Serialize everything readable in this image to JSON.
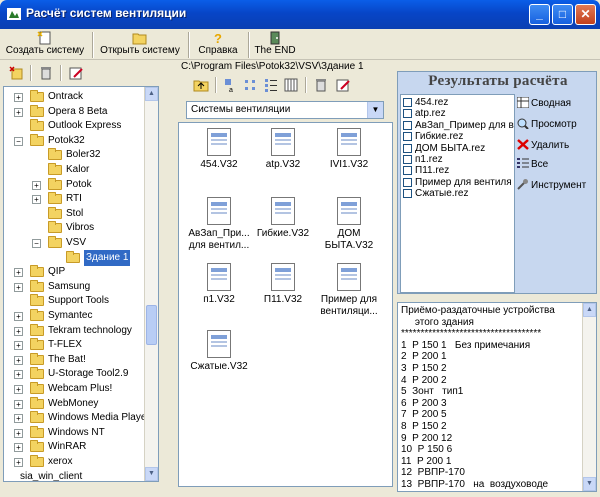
{
  "window": {
    "title": "Расчёт систем вентиляции",
    "minimize": "_",
    "maximize": "□",
    "close": "✕"
  },
  "toolbar": {
    "create": "Создать систему",
    "open": "Открыть систему",
    "help": "Справка",
    "end": "The END"
  },
  "path": "C:\\Program Files\\Potok32\\VSV\\Здание 1",
  "folder_combo": "Системы вентиляции",
  "tree": [
    {
      "label": "Ontrack",
      "expander": "+",
      "indent": 0
    },
    {
      "label": "Opera 8 Beta",
      "expander": "+",
      "indent": 0
    },
    {
      "label": "Outlook Express",
      "expander": "",
      "indent": 0
    },
    {
      "label": "Potok32",
      "expander": "−",
      "indent": 0
    },
    {
      "label": "Boler32",
      "expander": "",
      "indent": 1
    },
    {
      "label": "Kalor",
      "expander": "",
      "indent": 1
    },
    {
      "label": "Potok",
      "expander": "+",
      "indent": 1
    },
    {
      "label": "RTI",
      "expander": "+",
      "indent": 1
    },
    {
      "label": "Stol",
      "expander": "",
      "indent": 1
    },
    {
      "label": "Vibros",
      "expander": "",
      "indent": 1
    },
    {
      "label": "VSV",
      "expander": "−",
      "indent": 1
    },
    {
      "label": "Здание 1",
      "expander": "",
      "indent": 2,
      "selected": true
    },
    {
      "label": "QIP",
      "expander": "+",
      "indent": 0
    },
    {
      "label": "Samsung",
      "expander": "+",
      "indent": 0
    },
    {
      "label": "Support Tools",
      "expander": "",
      "indent": 0
    },
    {
      "label": "Symantec",
      "expander": "+",
      "indent": 0
    },
    {
      "label": "Tekram technology",
      "expander": "+",
      "indent": 0
    },
    {
      "label": "T-FLEX",
      "expander": "+",
      "indent": 0
    },
    {
      "label": "The Bat!",
      "expander": "+",
      "indent": 0
    },
    {
      "label": "U-Storage Tool2.9",
      "expander": "+",
      "indent": 0
    },
    {
      "label": "Webcam Plus!",
      "expander": "+",
      "indent": 0
    },
    {
      "label": "WebMoney",
      "expander": "+",
      "indent": 0
    },
    {
      "label": "Windows Media Playe",
      "expander": "+",
      "indent": 0
    },
    {
      "label": "Windows NT",
      "expander": "+",
      "indent": 0
    },
    {
      "label": "WinRAR",
      "expander": "+",
      "indent": 0
    },
    {
      "label": "xerox",
      "expander": "+",
      "indent": 0
    },
    {
      "label": "sia_win_client",
      "expander": "+",
      "indent": -1
    }
  ],
  "files": [
    [
      "454.V32"
    ],
    [
      "atp.V32"
    ],
    [
      "IVI1.V32"
    ],
    [
      "АвЗап_При...",
      "для вентил..."
    ],
    [
      "Гибкие.V32"
    ],
    [
      "ДОМ",
      "БЫТА.V32"
    ],
    [
      "п1.V32"
    ],
    [
      "П11.V32"
    ],
    [
      "Пример для",
      "вентиляци..."
    ],
    [
      "Сжатые.V32"
    ]
  ],
  "results": {
    "header": "Результаты расчёта",
    "items": [
      "454.rez",
      "atp.rez",
      "АвЗап_Пример для в",
      "Гибкие.rez",
      "ДОМ БЫТА.rez",
      "п1.rez",
      "П11.rez",
      "Пример для вентиля",
      "Сжатые.rez"
    ],
    "buttons": {
      "summary": "Сводная",
      "view": "Просмотр",
      "delete": "Удалить",
      "all": "Все",
      "tool": "Инструмент"
    }
  },
  "report": {
    "lines": [
      "Приёмо-раздаточные устройства",
      "     этого здания",
      "************************************",
      "1  Р 150 1   Без примечания",
      "2  Р 200 1",
      "3  Р 150 2",
      "4  Р 200 2",
      "5  Зонт   тип1",
      "6  Р 200 3",
      "7  Р 200 5",
      "8  Р 150 2",
      "9  Р 200 12",
      "10  Р 150 6",
      "11  Р 200 1",
      "12  РВПР-170",
      "13  РВПР-170   на  воздуховоде"
    ]
  }
}
